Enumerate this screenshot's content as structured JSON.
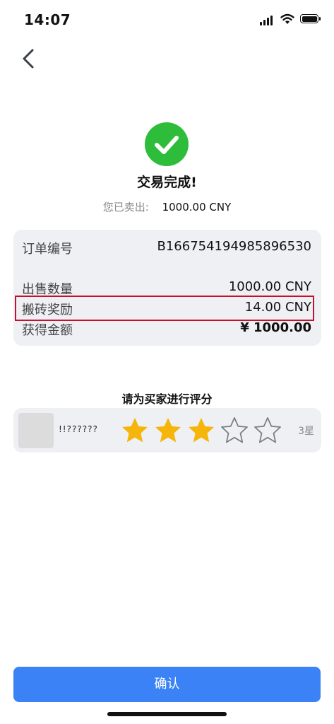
{
  "status_bar": {
    "time": "14:07"
  },
  "result": {
    "title": "交易完成!",
    "sold_label": "您已卖出:",
    "sold_value": "1000.00 CNY"
  },
  "summary": {
    "order_label": "订单编号",
    "order_value": "B166754194985896530",
    "quantity_label": "出售数量",
    "quantity_value": "1000.00 CNY",
    "reward_label": "搬砖奖励",
    "reward_value": "14.00 CNY",
    "received_label": "获得金额",
    "received_value": "¥ 1000.00"
  },
  "rating": {
    "prompt": "请为买家进行评分",
    "buyer_name": "!!??????",
    "stars_filled": 3,
    "stars_total": 5,
    "rating_text": "3星"
  },
  "confirm_label": "确认",
  "colors": {
    "success_green": "#2ebd3a",
    "star_filled": "#f5b50a",
    "star_empty_stroke": "#7a7f87",
    "primary_blue": "#3b82f6",
    "highlight_red": "#c8102e"
  }
}
